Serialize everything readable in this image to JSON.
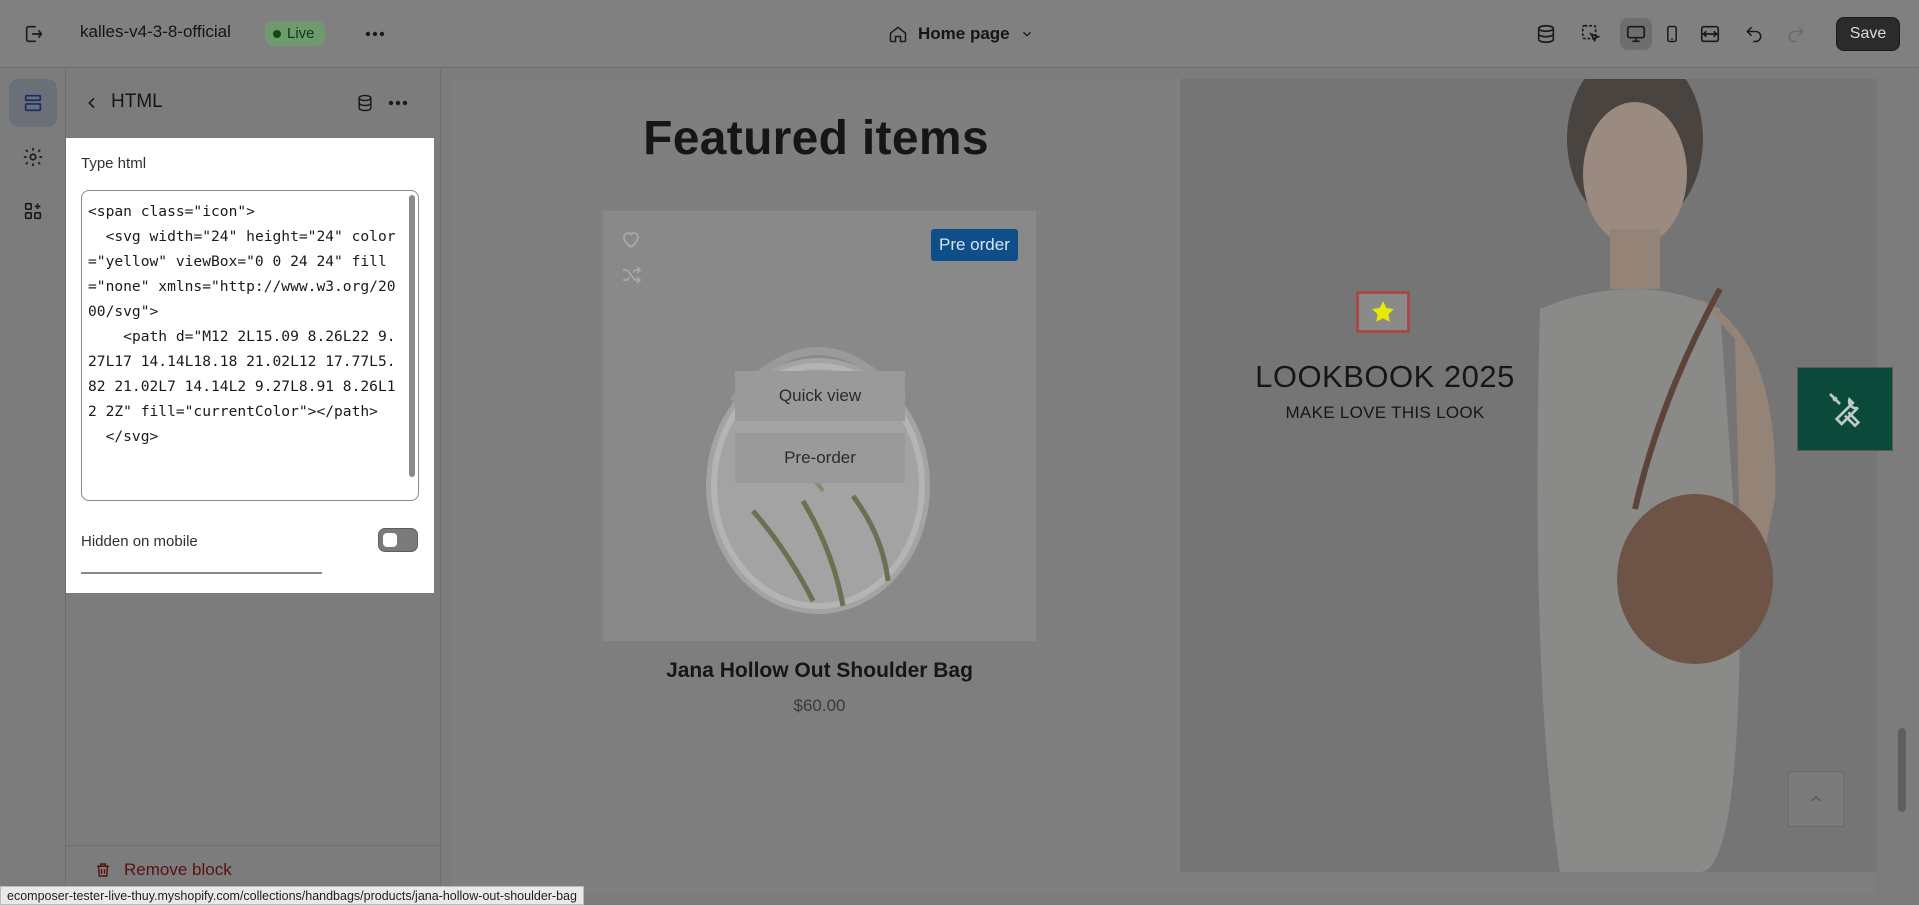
{
  "topbar": {
    "store_name": "kalles-v4-3-8-official",
    "live_label": "Live",
    "page_selector": "Home page",
    "save_label": "Save"
  },
  "panel": {
    "title": "HTML",
    "type_html_label": "Type html",
    "code": "<span class=\"icon\">\n  <svg width=\"24\" height=\"24\" color=\"yellow\" viewBox=\"0 0 24 24\" fill=\"none\" xmlns=\"http://www.w3.org/2000/svg\">\n    <path d=\"M12 2L15.09 8.26L22 9.27L17 14.14L18.18 21.02L12 17.77L5.82 21.02L7 14.14L2 9.27L8.91 8.26L12 2Z\" fill=\"currentColor\"></path>\n  </svg>",
    "hidden_on_mobile_label": "Hidden on mobile",
    "hidden_on_mobile": false,
    "remove_label": "Remove block"
  },
  "preview": {
    "featured_title": "Featured items",
    "product": {
      "badge": "Pre order",
      "quick_view": "Quick view",
      "pre_order": "Pre-order",
      "name": "Jana Hollow Out Shoulder Bag",
      "price": "$60.00"
    },
    "lookbook": {
      "title": "LOOKBOOK 2025",
      "subtitle": "MAKE LOVE THIS LOOK",
      "star_color": "#e8e800"
    }
  },
  "status_url": "ecomposer-tester-live-thuy.myshopify.com/collections/handbags/products/jana-hollow-out-shoulder-bag",
  "colors": {
    "accent_save": "#2b2b2b",
    "live_badge": "#6f9a6f",
    "preorder_badge": "#0e4f8a",
    "tool_fab": "#0b4a3a",
    "remove": "#5a1010"
  }
}
